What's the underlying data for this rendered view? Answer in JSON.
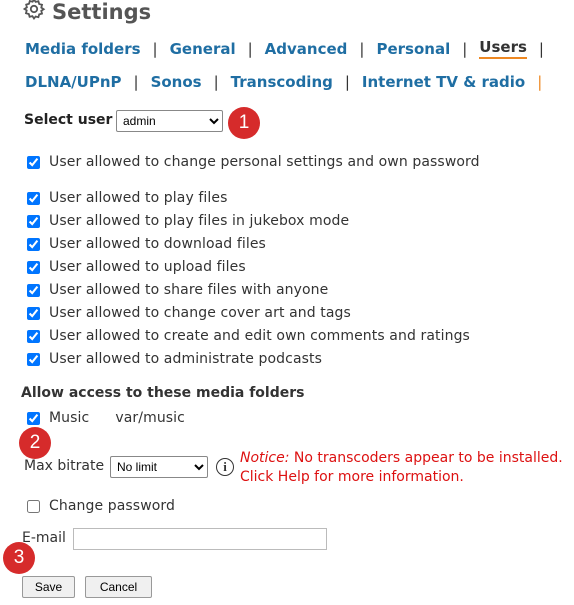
{
  "page": {
    "title": "Settings"
  },
  "nav": {
    "row1": [
      "Media folders",
      "General",
      "Advanced",
      "Personal",
      "Users"
    ],
    "row2": [
      "DLNA/UPnP",
      "Sonos",
      "Transcoding",
      "Internet TV & radio"
    ],
    "active": "Users"
  },
  "user_select": {
    "label": "Select user",
    "value": "admin",
    "badge": "1"
  },
  "permissions": {
    "personal": "User allowed to change personal settings and own password",
    "items": [
      "User allowed to play files",
      "User allowed to play files in jukebox mode",
      "User allowed to download files",
      "User allowed to upload files",
      "User allowed to share files with anyone",
      "User allowed to change cover art and tags",
      "User allowed to create and edit own comments and ratings",
      "User allowed to administrate podcasts"
    ]
  },
  "media_folders": {
    "heading": "Allow access to these media folders",
    "folder_name": "Music",
    "folder_path": "var/music",
    "badge": "2"
  },
  "bitrate": {
    "label": "Max bitrate",
    "value": "No limit",
    "notice_prefix": "Notice:",
    "notice_line1": " No transcoders appear to be installed.",
    "notice_line2": "Click Help for more information."
  },
  "password": {
    "label": "Change password"
  },
  "email": {
    "label": "E-mail",
    "value": ""
  },
  "actions": {
    "save": "Save",
    "cancel": "Cancel",
    "badge": "3"
  },
  "colors": {
    "link": "#1f6ea3",
    "active_underline": "#ee8822",
    "badge": "#d62b2b",
    "notice": "#dd1111"
  }
}
